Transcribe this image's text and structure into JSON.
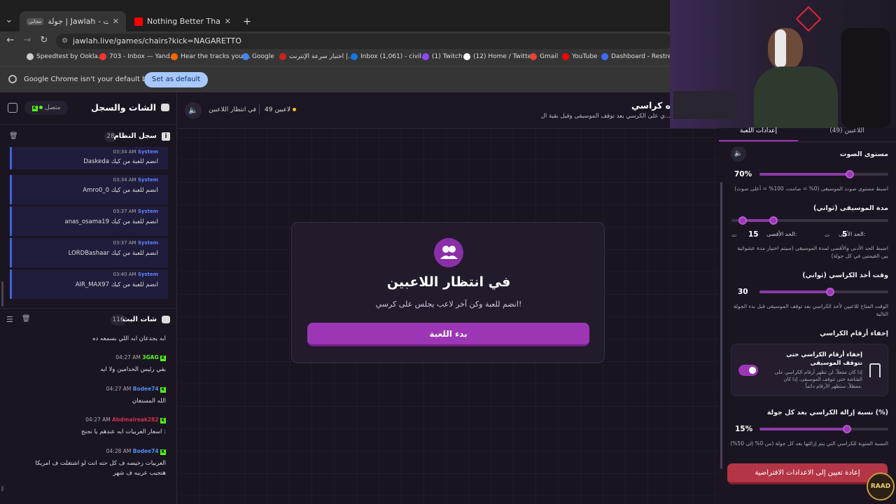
{
  "browser": {
    "tabs": [
      {
        "label": "جولة | Jawlah - منصة الألعاب الت...",
        "badge": "مجاني"
      },
      {
        "label": "Nothing Better Than The Super..."
      }
    ],
    "new_tab": "+",
    "url": "jawlah.live/games/chairs?kick=NAGARETTO",
    "bookmarks": [
      "Speedtest by Ookla...",
      "703 - Inbox — Yand...",
      "Hear the tracks you'...",
      "Google",
      "اختبار سرعة الإنترنت |...",
      "Inbox (1,061) - civil...",
      "(1) Twitch",
      "(12) Home / Twitter",
      "Gmail",
      "YouTube",
      "Dashboard - Restre..."
    ],
    "infobar_text": "Google Chrome isn't your default browser",
    "set_default": "Set as default"
  },
  "left_panel": {
    "title": "الشات والسجل",
    "status": "متصل",
    "system_log": {
      "title": "سجل النظام",
      "count": "28",
      "messages": [
        {
          "sender": "System",
          "time": "03:34 AM",
          "text": "Daskeda انضم للعبة من كيك"
        },
        {
          "sender": "System",
          "time": "03:34 AM",
          "text": "Amro0_0 انضم للعبة من كيك"
        },
        {
          "sender": "System",
          "time": "03:37 AM",
          "text": "anas_osama19 انضم للعبة من كيك"
        },
        {
          "sender": "System",
          "time": "03:37 AM",
          "text": "LORDBashaar انضم للعبة من كيك"
        },
        {
          "sender": "System",
          "time": "03:40 AM",
          "text": "AIR_MAX97 انضم للعبة من كيك"
        }
      ]
    },
    "stream_chat": {
      "title": "شات البث",
      "count": "116",
      "top_text": "ابه يجدعان ابه اللي بسمعه ده",
      "messages": [
        {
          "user": "3GAG",
          "user_color": "#53fc18",
          "time": "04:27 AM",
          "text": "بقي رئيس الخدامين ولا ايه"
        },
        {
          "user": "Bodee74",
          "user_color": "#4e8df5",
          "time": "04:27 AM",
          "text": "الله المستعان"
        },
        {
          "user": "Abdmaireak282",
          "user_color": "#c9314a",
          "time": "04:27 AM",
          "text": "اسعار العربيات ابه عندهم يا نجنج :"
        },
        {
          "user": "Bodee74",
          "user_color": "#4e8df5",
          "time": "04:28 AM",
          "text": "العربيات رخيصه ف كل حته انت لو اشتغلت ف امريكا",
          "text2": "هتجيب عربيه ف شهر"
        }
      ]
    }
  },
  "main": {
    "header_title": "ه كراسي",
    "header_sub": "ي على الكرسي بعد توقف الموسيقى وقبل بقية ال...",
    "players_count": "49 لاعبين",
    "waiting_status": "في انتظار اللاعبين",
    "card": {
      "title": "في انتظار اللاعبين",
      "subtitle": "انضم للعبة وكن آخر لاعب يجلس على كرسي!",
      "start_button": "بدء اللعبة"
    }
  },
  "settings": {
    "tabs": {
      "players": "اللاعبين (49)",
      "game_settings": "إعدادات اللعبة"
    },
    "volume": {
      "label": "مستوى الصوت",
      "value_text": "70%",
      "value": 0.7,
      "desc": "اضبط مستوى صوت الموسيقى (0% = صامت، 100% = أعلى صوت)"
    },
    "music_duration": {
      "label": "مدة الموسيقى (ثواني)",
      "min_label": "الحد الأدنى:",
      "min_value": "5",
      "max_label": "الحد الأقصى:",
      "max_value": "15",
      "unit": "ث",
      "range": [
        0.07,
        0.27
      ],
      "desc": "اضبط الحد الأدنى والأقصى لمدة الموسيقى (سيتم اختيار مدة عشوائية بين القيمتين في كل جولة)"
    },
    "chair_time": {
      "label": "وقت أخذ الكراسي (ثواني)",
      "value_text": "30",
      "value": 0.55,
      "desc": "الوقت المتاح للاعبين لأخذ الكراسي بعد توقف الموسيقى قبل بدء الجولة التالية"
    },
    "hide_numbers": {
      "section_label": "إخفاء أرقام الكراسي",
      "title": "إخفاء أرقام الكراسي حتى تتوقف الموسيقى",
      "desc": "إذا كان مفعلاً، لن تظهر أرقام الكراسي على الشاشة حتى تتوقف الموسيقى. إذا كان معطلاً، ستظهر الأرقام دائماً.",
      "enabled": true
    },
    "removal": {
      "label": "نسبة إزالة الكراسي بعد كل جولة (%)",
      "value_text": "15%",
      "value": 0.68,
      "desc": "النسبة المئوية للكراسي التي يتم إزالتها بعد كل جولة (من 0% إلى 50%)"
    },
    "reset_button": "إعادة تعيين إلى الاعدادات الافتراضية"
  },
  "watermark": "RAAD",
  "colors": {
    "accent": "#9c36b5",
    "danger": "#b43545",
    "kick_green": "#53fc18",
    "system_blue": "#5b82ff"
  }
}
